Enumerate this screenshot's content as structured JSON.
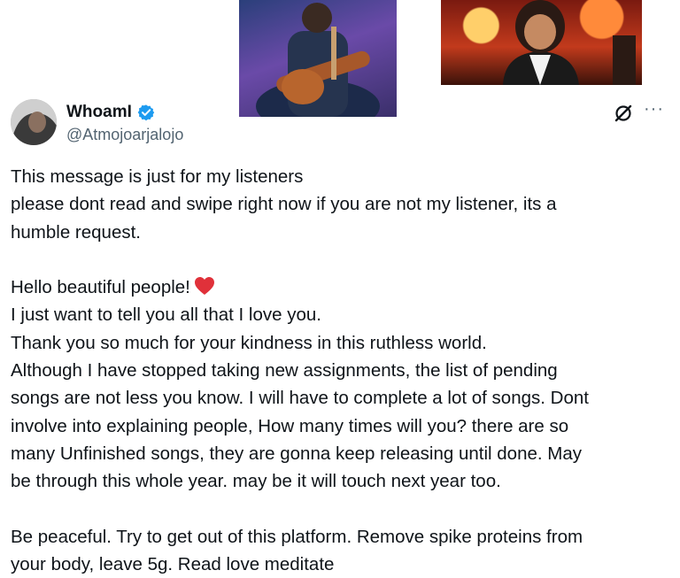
{
  "header": {
    "display_name": "WhoamI",
    "handle": "@Atmojoarjalojo",
    "more_label": "···"
  },
  "post": {
    "line1": "This message is just for my listeners",
    "line2": "please dont read and swipe right now if you are not my listener, its a",
    "line3": "humble request.",
    "line4": "Hello beautiful people!",
    "line5": "I just want to tell you all that I love you.",
    "line6": "Thank you so much for your kindness in this ruthless world.",
    "line7": "Although I have stopped taking new assignments, the list of pending",
    "line8": "songs are not less you know. I will have to complete a lot of songs. Dont",
    "line9": "involve into explaining people, How many times will you? there are so",
    "line10": "many Unfinished songs, they are gonna keep releasing until done. May",
    "line11": "be through this whole year. may be it will touch next year too.",
    "line12": "Be peaceful. Try to get out of this platform. Remove spike proteins from",
    "line13": "your body, leave 5g. Read love meditate"
  },
  "icons": {
    "verified": "verified-badge-icon",
    "grok": "grok-icon",
    "more": "more-icon",
    "heart": "red-heart-emoji"
  },
  "colors": {
    "text": "#0f1419",
    "secondary": "#536471",
    "verified": "#1d9bf0",
    "heart": "#e0313a"
  }
}
